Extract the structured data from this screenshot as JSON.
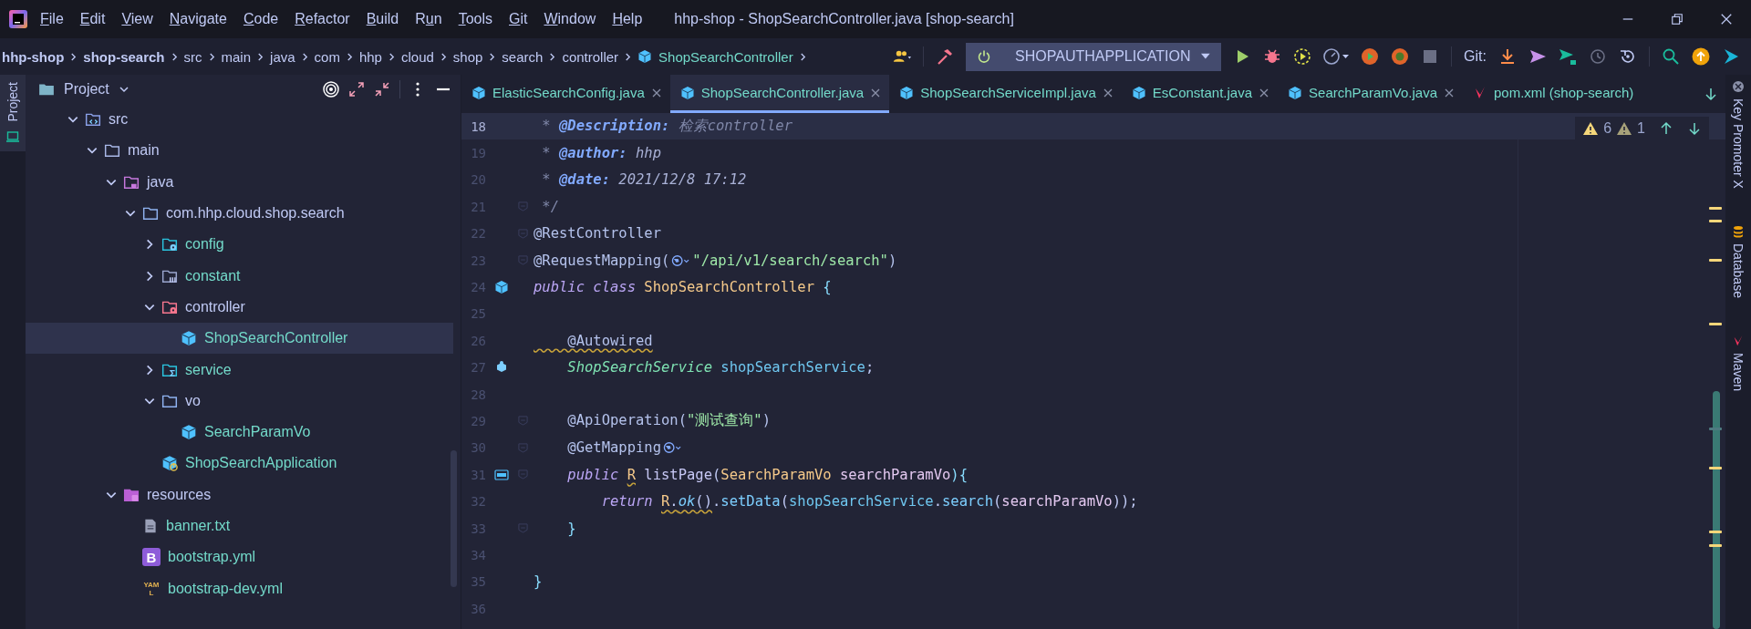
{
  "window": {
    "title": "hhp-shop - ShopSearchController.java [shop-search]"
  },
  "menu": [
    {
      "key": "F",
      "after": "ile"
    },
    {
      "key": "E",
      "after": "dit"
    },
    {
      "key": "V",
      "after": "iew"
    },
    {
      "key": "N",
      "after": "avigate"
    },
    {
      "key": "C",
      "after": "ode"
    },
    {
      "key": "R",
      "after": "efactor"
    },
    {
      "key": "B",
      "after": "uild"
    },
    {
      "before": "R",
      "key": "u",
      "after": "n"
    },
    {
      "key": "T",
      "after": "ools"
    },
    {
      "key": "G",
      "after": "it"
    },
    {
      "key": "W",
      "after": "indow"
    },
    {
      "key": "H",
      "after": "elp"
    }
  ],
  "breadcrumbs": [
    {
      "label": "hhp-shop",
      "bold": true,
      "kind": "dir"
    },
    {
      "label": "shop-search",
      "bold": true,
      "kind": "dir"
    },
    {
      "label": "src",
      "bold": false,
      "kind": "dir"
    },
    {
      "label": "main",
      "bold": false,
      "kind": "dir"
    },
    {
      "label": "java",
      "bold": false,
      "kind": "dir"
    },
    {
      "label": "com",
      "bold": false,
      "kind": "dir"
    },
    {
      "label": "hhp",
      "bold": false,
      "kind": "dir"
    },
    {
      "label": "cloud",
      "bold": false,
      "kind": "dir"
    },
    {
      "label": "shop",
      "bold": false,
      "kind": "dir"
    },
    {
      "label": "search",
      "bold": false,
      "kind": "dir"
    },
    {
      "label": "controller",
      "bold": false,
      "kind": "dir"
    },
    {
      "label": "ShopSearchController",
      "bold": false,
      "kind": "class"
    }
  ],
  "run_config": {
    "name": "SHOPAUTHAPPLICATION"
  },
  "git_label": "Git:",
  "left_strip": [
    {
      "label": "Project",
      "selected": true
    }
  ],
  "project": {
    "title": "Project",
    "tree": [
      {
        "label": "src",
        "kind": "source-folder",
        "expanded": true,
        "selected": false,
        "children": [
          {
            "label": "main",
            "kind": "folder",
            "expanded": true,
            "selected": false,
            "children": [
              {
                "label": "java",
                "kind": "java-folder",
                "expanded": true,
                "selected": false,
                "children": [
                  {
                    "label": "com.hhp.cloud.shop.search",
                    "kind": "package",
                    "expanded": true,
                    "selected": false,
                    "children": [
                      {
                        "label": "config",
                        "kind": "config-package",
                        "expanded": false,
                        "selected": false
                      },
                      {
                        "label": "constant",
                        "kind": "constant-package",
                        "expanded": false,
                        "selected": false
                      },
                      {
                        "label": "controller",
                        "kind": "controller-package",
                        "expanded": true,
                        "selected": false,
                        "children": [
                          {
                            "label": "ShopSearchController",
                            "kind": "class",
                            "selected": true
                          }
                        ]
                      },
                      {
                        "label": "service",
                        "kind": "service-package",
                        "expanded": false,
                        "selected": false
                      },
                      {
                        "label": "vo",
                        "kind": "package",
                        "expanded": true,
                        "selected": false,
                        "children": [
                          {
                            "label": "SearchParamVo",
                            "kind": "class",
                            "selected": false
                          }
                        ]
                      },
                      {
                        "label": "ShopSearchApplication",
                        "kind": "app-class",
                        "selected": false
                      }
                    ]
                  }
                ]
              },
              {
                "label": "resources",
                "kind": "resources-folder",
                "expanded": true,
                "selected": false,
                "children": [
                  {
                    "label": "banner.txt",
                    "kind": "text-file",
                    "selected": false
                  },
                  {
                    "label": "bootstrap.yml",
                    "kind": "bootstrap-file",
                    "icon_text": "B",
                    "selected": false
                  },
                  {
                    "label": "bootstrap-dev.yml",
                    "kind": "yaml-file",
                    "icon_text": "YAML",
                    "selected": false
                  }
                ]
              }
            ]
          }
        ]
      }
    ]
  },
  "tabs": [
    {
      "label": "ElasticSearchConfig.java",
      "kind": "class",
      "selected": false,
      "closable": true
    },
    {
      "label": "ShopSearchController.java",
      "kind": "class",
      "selected": true,
      "closable": true
    },
    {
      "label": "ShopSearchServiceImpl.java",
      "kind": "class",
      "selected": false,
      "closable": true
    },
    {
      "label": "EsConstant.java",
      "kind": "class",
      "selected": false,
      "closable": true
    },
    {
      "label": "SearchParamVo.java",
      "kind": "class",
      "selected": false,
      "closable": true
    },
    {
      "label": "pom.xml (shop-search)",
      "kind": "maven",
      "selected": false,
      "closable": false
    }
  ],
  "inspections": {
    "warnings": "6",
    "weak_warnings": "1"
  },
  "code": [
    {
      "number": "18",
      "current": true,
      "fold": false,
      "tokens": [
        {
          "text": " * ",
          "kind": "comment"
        },
        {
          "text": "@Description:",
          "kind": "doctag"
        },
        {
          "text": " 检索controller",
          "kind": "comment"
        }
      ]
    },
    {
      "number": "19",
      "current": false,
      "fold": false,
      "tokens": [
        {
          "text": " * ",
          "kind": "comment"
        },
        {
          "text": "@author:",
          "kind": "doctag"
        },
        {
          "text": " hhp",
          "kind": "docvalue"
        }
      ]
    },
    {
      "number": "20",
      "current": false,
      "fold": false,
      "tokens": [
        {
          "text": " * ",
          "kind": "comment"
        },
        {
          "text": "@date:",
          "kind": "doctag"
        },
        {
          "text": " 2021/12/8 17:12",
          "kind": "docvalue"
        }
      ]
    },
    {
      "number": "21",
      "current": false,
      "fold": true,
      "tokens": [
        {
          "text": " */",
          "kind": "comment"
        }
      ]
    },
    {
      "number": "22",
      "current": false,
      "fold": true,
      "tokens": [
        {
          "text": "@RestController",
          "kind": "annotation"
        }
      ]
    },
    {
      "number": "23",
      "current": false,
      "fold": true,
      "tokens": [
        {
          "text": "@RequestMapping(",
          "kind": "annotation"
        },
        {
          "kind": "globe"
        },
        {
          "text": "\"/api/v1/search/search\"",
          "kind": "string"
        },
        {
          "text": ")",
          "kind": "annotation"
        }
      ]
    },
    {
      "number": "24",
      "current": false,
      "fold": false,
      "gutter": {
        "kind": "class"
      },
      "tokens": [
        {
          "text": "public class ",
          "kind": "keyword"
        },
        {
          "text": "ShopSearchController",
          "kind": "classname"
        },
        {
          "text": " {",
          "kind": "brace"
        }
      ]
    },
    {
      "number": "25",
      "current": false,
      "fold": false
    },
    {
      "number": "26",
      "current": false,
      "fold": false,
      "tokens": [
        {
          "text": "    @Autowired",
          "kind": "annotation",
          "warning": true
        }
      ]
    },
    {
      "number": "27",
      "current": false,
      "fold": false,
      "gutter": {
        "kind": "bean"
      },
      "tokens": [
        {
          "text": "    ShopSearchService",
          "kind": "type"
        },
        {
          "text": " shopSearchService",
          "kind": "field"
        },
        {
          "text": ";",
          "kind": "plain"
        }
      ]
    },
    {
      "number": "28",
      "current": false,
      "fold": false
    },
    {
      "number": "29",
      "current": false,
      "fold": true,
      "tokens": [
        {
          "text": "    @ApiOperation(",
          "kind": "annotation"
        },
        {
          "text": "\"测试查询\"",
          "kind": "string"
        },
        {
          "text": ")",
          "kind": "annotation"
        }
      ]
    },
    {
      "number": "30",
      "current": false,
      "fold": true,
      "tokens": [
        {
          "text": "    @GetMapping",
          "kind": "annotation"
        },
        {
          "kind": "globe"
        }
      ]
    },
    {
      "number": "31",
      "current": false,
      "fold": true,
      "gutter": {
        "kind": "api"
      },
      "tokens": [
        {
          "text": "    public ",
          "kind": "keyword"
        },
        {
          "text": "R",
          "kind": "classname",
          "warning": true
        },
        {
          "text": " listPage",
          "kind": "method"
        },
        {
          "text": "(",
          "kind": "plain"
        },
        {
          "text": "SearchParamVo",
          "kind": "classname"
        },
        {
          "text": " searchParamVo",
          "kind": "param"
        },
        {
          "text": "){",
          "kind": "brace"
        }
      ]
    },
    {
      "number": "32",
      "current": false,
      "fold": false,
      "tokens": [
        {
          "text": "        return ",
          "kind": "keyword"
        },
        {
          "text": "R",
          "kind": "classname",
          "warning": true
        },
        {
          "text": ".",
          "kind": "plain",
          "warning": true
        },
        {
          "text": "ok",
          "kind": "static",
          "warning": true
        },
        {
          "text": "()",
          "kind": "plain",
          "warning": true
        },
        {
          "text": ".",
          "kind": "plain"
        },
        {
          "text": "setData",
          "kind": "call"
        },
        {
          "text": "(",
          "kind": "plain"
        },
        {
          "text": "shopSearchService",
          "kind": "field"
        },
        {
          "text": ".",
          "kind": "plain"
        },
        {
          "text": "search",
          "kind": "call"
        },
        {
          "text": "(",
          "kind": "plain"
        },
        {
          "text": "searchParamVo",
          "kind": "param"
        },
        {
          "text": "));",
          "kind": "plain"
        }
      ]
    },
    {
      "number": "33",
      "current": false,
      "fold": true,
      "tokens": [
        {
          "text": "    }",
          "kind": "brace"
        }
      ]
    },
    {
      "number": "34",
      "current": false,
      "fold": false
    },
    {
      "number": "35",
      "current": false,
      "fold": false,
      "tokens": [
        {
          "text": "}",
          "kind": "brace"
        }
      ]
    },
    {
      "number": "36",
      "current": false,
      "fold": false
    }
  ],
  "right_strip": [
    {
      "label": "Key Promoter X",
      "kind": "keypromoter"
    },
    {
      "label": "Database",
      "kind": "database"
    },
    {
      "label": "Maven",
      "kind": "maven"
    }
  ]
}
